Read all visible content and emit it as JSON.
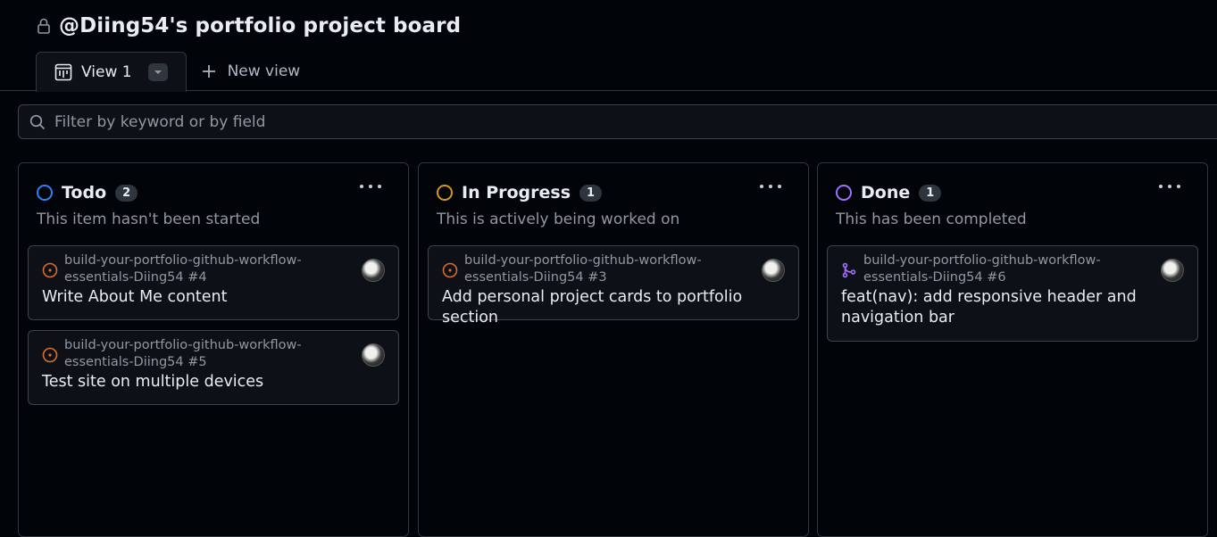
{
  "board": {
    "title": "@Diing54's portfolio project board"
  },
  "tabs": [
    {
      "label": "View 1"
    }
  ],
  "new_view_label": "New view",
  "filter": {
    "placeholder": "Filter by keyword or by field"
  },
  "colors": {
    "todo": "#2f81f7",
    "in_progress": "#d29922",
    "done": "#a371f7",
    "open_issue": "#db6d28",
    "merged_pr": "#a371f7"
  },
  "columns": [
    {
      "title": "Todo",
      "count": "2",
      "description": "This item hasn't been started",
      "cards": [
        {
          "icon": "issue-opened-icon",
          "repo": "build-your-portfolio-github-workflow-essentials-Diing54 #4",
          "title": "Write About Me content"
        },
        {
          "icon": "issue-opened-icon",
          "repo": "build-your-portfolio-github-workflow-essentials-Diing54 #5",
          "title": "Test site on multiple devices"
        }
      ]
    },
    {
      "title": "In Progress",
      "count": "1",
      "description": "This is actively being worked on",
      "cards": [
        {
          "icon": "issue-opened-icon",
          "repo": "build-your-portfolio-github-workflow-essentials-Diing54 #3",
          "title": "Add personal project cards to portfolio section"
        }
      ]
    },
    {
      "title": "Done",
      "count": "1",
      "description": "This has been completed",
      "cards": [
        {
          "icon": "pull-request-merged-icon",
          "repo": "build-your-portfolio-github-workflow-essentials-Diing54 #6",
          "title": "feat(nav): add responsive header and navigation bar"
        }
      ]
    }
  ]
}
